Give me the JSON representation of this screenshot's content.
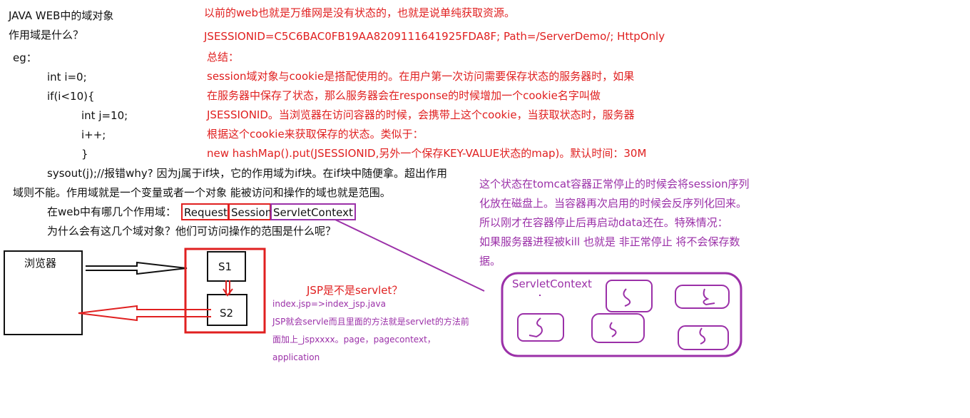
{
  "left_notes": {
    "title": "JAVA WEB中的域对象",
    "question": "作用域是什么？",
    "eg": "eg：",
    "code": [
      "int i=0;",
      "if(i<10){",
      "int j=10;",
      "i++;",
      "}"
    ],
    "sysout_line1": "sysout(j);//报错why? 因为j属于if块，它的作用域为if块。在if块中随便拿。超出作用",
    "sysout_line2": "域则不能。作用域就是一个变量或者一个对象 能被访问和操作的域也就是范围。",
    "scopes_prefix": "在web中有哪几个作用域：",
    "scopes": [
      "Request",
      "Session",
      "ServletContext"
    ],
    "why_line": "为什么会有这几个域对象？他们可访问操作的范围是什么呢？"
  },
  "right_notes": {
    "line1": "以前的web也就是万维网是没有状态的，也就是说单纯获取资源。",
    "cookie": "JSESSIONID=C5C6BAC0FB19AA8209111641925FDA8F; Path=/ServerDemo/; HttpOnly",
    "summary_title": "总结：",
    "summary_lines": [
      "session域对象与cookie是搭配使用的。在用户第一次访问需要保存状态的服务器时，如果",
      "在服务器中保存了状态，那么服务器会在response的时候增加一个cookie名字叫做",
      "JSESSIONID。当浏览器在访问容器的时候，会携带上这个cookie，当获取状态时，服务器",
      "根据这个cookie来获取保存的状态。类似于：",
      "new hashMap().put(JSESSIONID,另外一个保存KEY-VALUE状态的map)。默认时间：30M"
    ]
  },
  "tomcat_note": [
    "这个状态在tomcat容器正常停止的时候会将session序列",
    "化放在磁盘上。当容器再次启用的时候会反序列化回来。",
    "所以刚才在容器停止后再启动data还在。特殊情况：",
    "如果服务器进程被kill 也就是 非正常停止 将不会保存数",
    "据。"
  ],
  "diagram": {
    "browser_label": "浏览器",
    "s1": "S1",
    "s2": "S2",
    "servlet_context_label": "ServletContext"
  },
  "jsp_note": {
    "title": "JSP是不是servlet？",
    "lines": [
      "index.jsp=>index_jsp.java",
      "JSP就会servle而且里面的方法就是servlet的方法前",
      "面加上_jspxxxx。page，pagecontext，",
      "application"
    ]
  },
  "colors": {
    "red": "#e02020",
    "purple": "#9b30a8",
    "black": "#111111"
  }
}
